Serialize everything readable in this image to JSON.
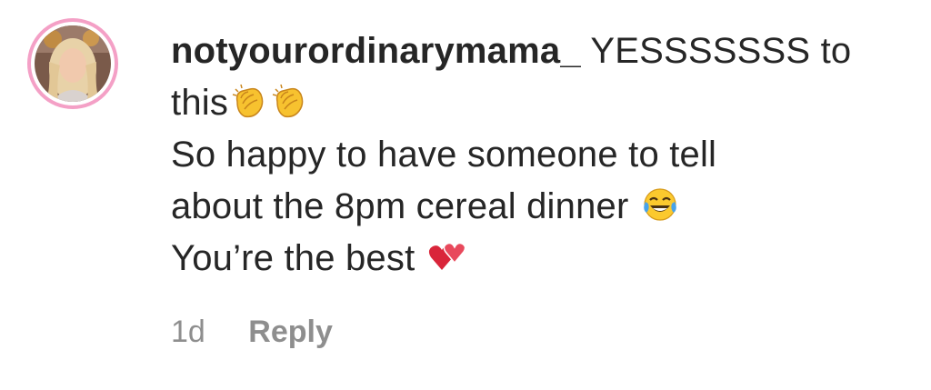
{
  "comment": {
    "username": "notyourordinarymama_",
    "line1_text": " YESSSSSSS to",
    "line2_text": "this",
    "line3_text": "So happy to have someone to tell",
    "line4_text": "about the 8pm cereal dinner ",
    "line5_text": "You’re the best ",
    "emojis": {
      "clap": "clapping-hands",
      "laugh": "face-with-tears-of-joy",
      "hearts": "two-hearts"
    },
    "time": "1d",
    "reply_label": "Reply"
  },
  "colors": {
    "text": "#262626",
    "meta": "#8e8e8e",
    "avatar_ring": "#f4a0c6"
  }
}
